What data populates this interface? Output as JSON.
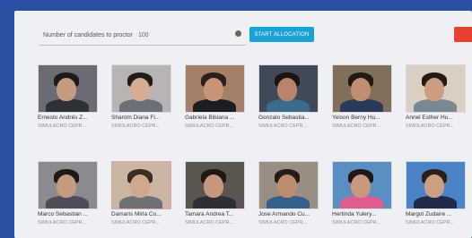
{
  "controls": {
    "count_label": "Number of candidates to proctor",
    "count_value": "100",
    "start_button": "START ALLOCATION"
  },
  "tiles": [
    {
      "name": "Ernesto Andrés Z...",
      "sub": "SIMULACRO CEPR...",
      "bg": "#6b6b75",
      "face": "#c59a7f",
      "hair": "#1e1a18",
      "shirt": "#2e3138"
    },
    {
      "name": "Sharom Diana Fl...",
      "sub": "SIMULACRO CEPR...",
      "bg": "#b7b4b3",
      "face": "#d4ad93",
      "hair": "#221c1a",
      "shirt": "#6b6f78"
    },
    {
      "name": "Gabriela Bibiana ...",
      "sub": "SIMULACRO CEPR...",
      "bg": "#a58069",
      "face": "#c89478",
      "hair": "#2b211c",
      "shirt": "#1c1d21"
    },
    {
      "name": "Gonzalo Sebastia...",
      "sub": "SIMULACRO CEPR...",
      "bg": "#3f4a58",
      "face": "#b7866a",
      "hair": "#1a1614",
      "shirt": "#3c6a8b"
    },
    {
      "name": "Yeison Berny Hu...",
      "sub": "SIMULACRO CEPR...",
      "bg": "#826f5b",
      "face": "#c08e70",
      "hair": "#201915",
      "shirt": "#2a3a5a"
    },
    {
      "name": "Annel Esther Hu...",
      "sub": "SIMULACRO CEPR...",
      "bg": "#d9cfc2",
      "face": "#cc9d80",
      "hair": "#231a16",
      "shirt": "#7a8794"
    },
    {
      "name": "Marco Sebastian ...",
      "sub": "SIMULACRO CEPR...",
      "bg": "#8a8a8f",
      "face": "#c59a7f",
      "hair": "#1f1916",
      "shirt": "#4b4f5a"
    },
    {
      "name": "Damaris Mirla Co...",
      "sub": "SIMULACRO CEPR...",
      "bg": "#c9b7a3",
      "face": "#d1a88e",
      "hair": "#3a2c25",
      "shirt": "#6f7076"
    },
    {
      "name": "Tamara Andrea T...",
      "sub": "SIMULACRO CEPR...",
      "bg": "#5b5550",
      "face": "#c5977b",
      "hair": "#1e1816",
      "shirt": "#2d2f36"
    },
    {
      "name": "Jose Armando Cu...",
      "sub": "SIMULACRO CEPR...",
      "bg": "#9a8d82",
      "face": "#bd8c6f",
      "hair": "#241c18",
      "shirt": "#35608a"
    },
    {
      "name": "Hertinda Yulery...",
      "sub": "SIMULACRO CEPR...",
      "bg": "#5a8fc4",
      "face": "#c8997c",
      "hair": "#201816",
      "shirt": "#e05b8e"
    },
    {
      "name": "Margot Zudaire ...",
      "sub": "SIMULACRO CEPR...",
      "bg": "#4a84c7",
      "face": "#cc9f83",
      "hair": "#2a201b",
      "shirt": "#1e2b4a"
    }
  ]
}
